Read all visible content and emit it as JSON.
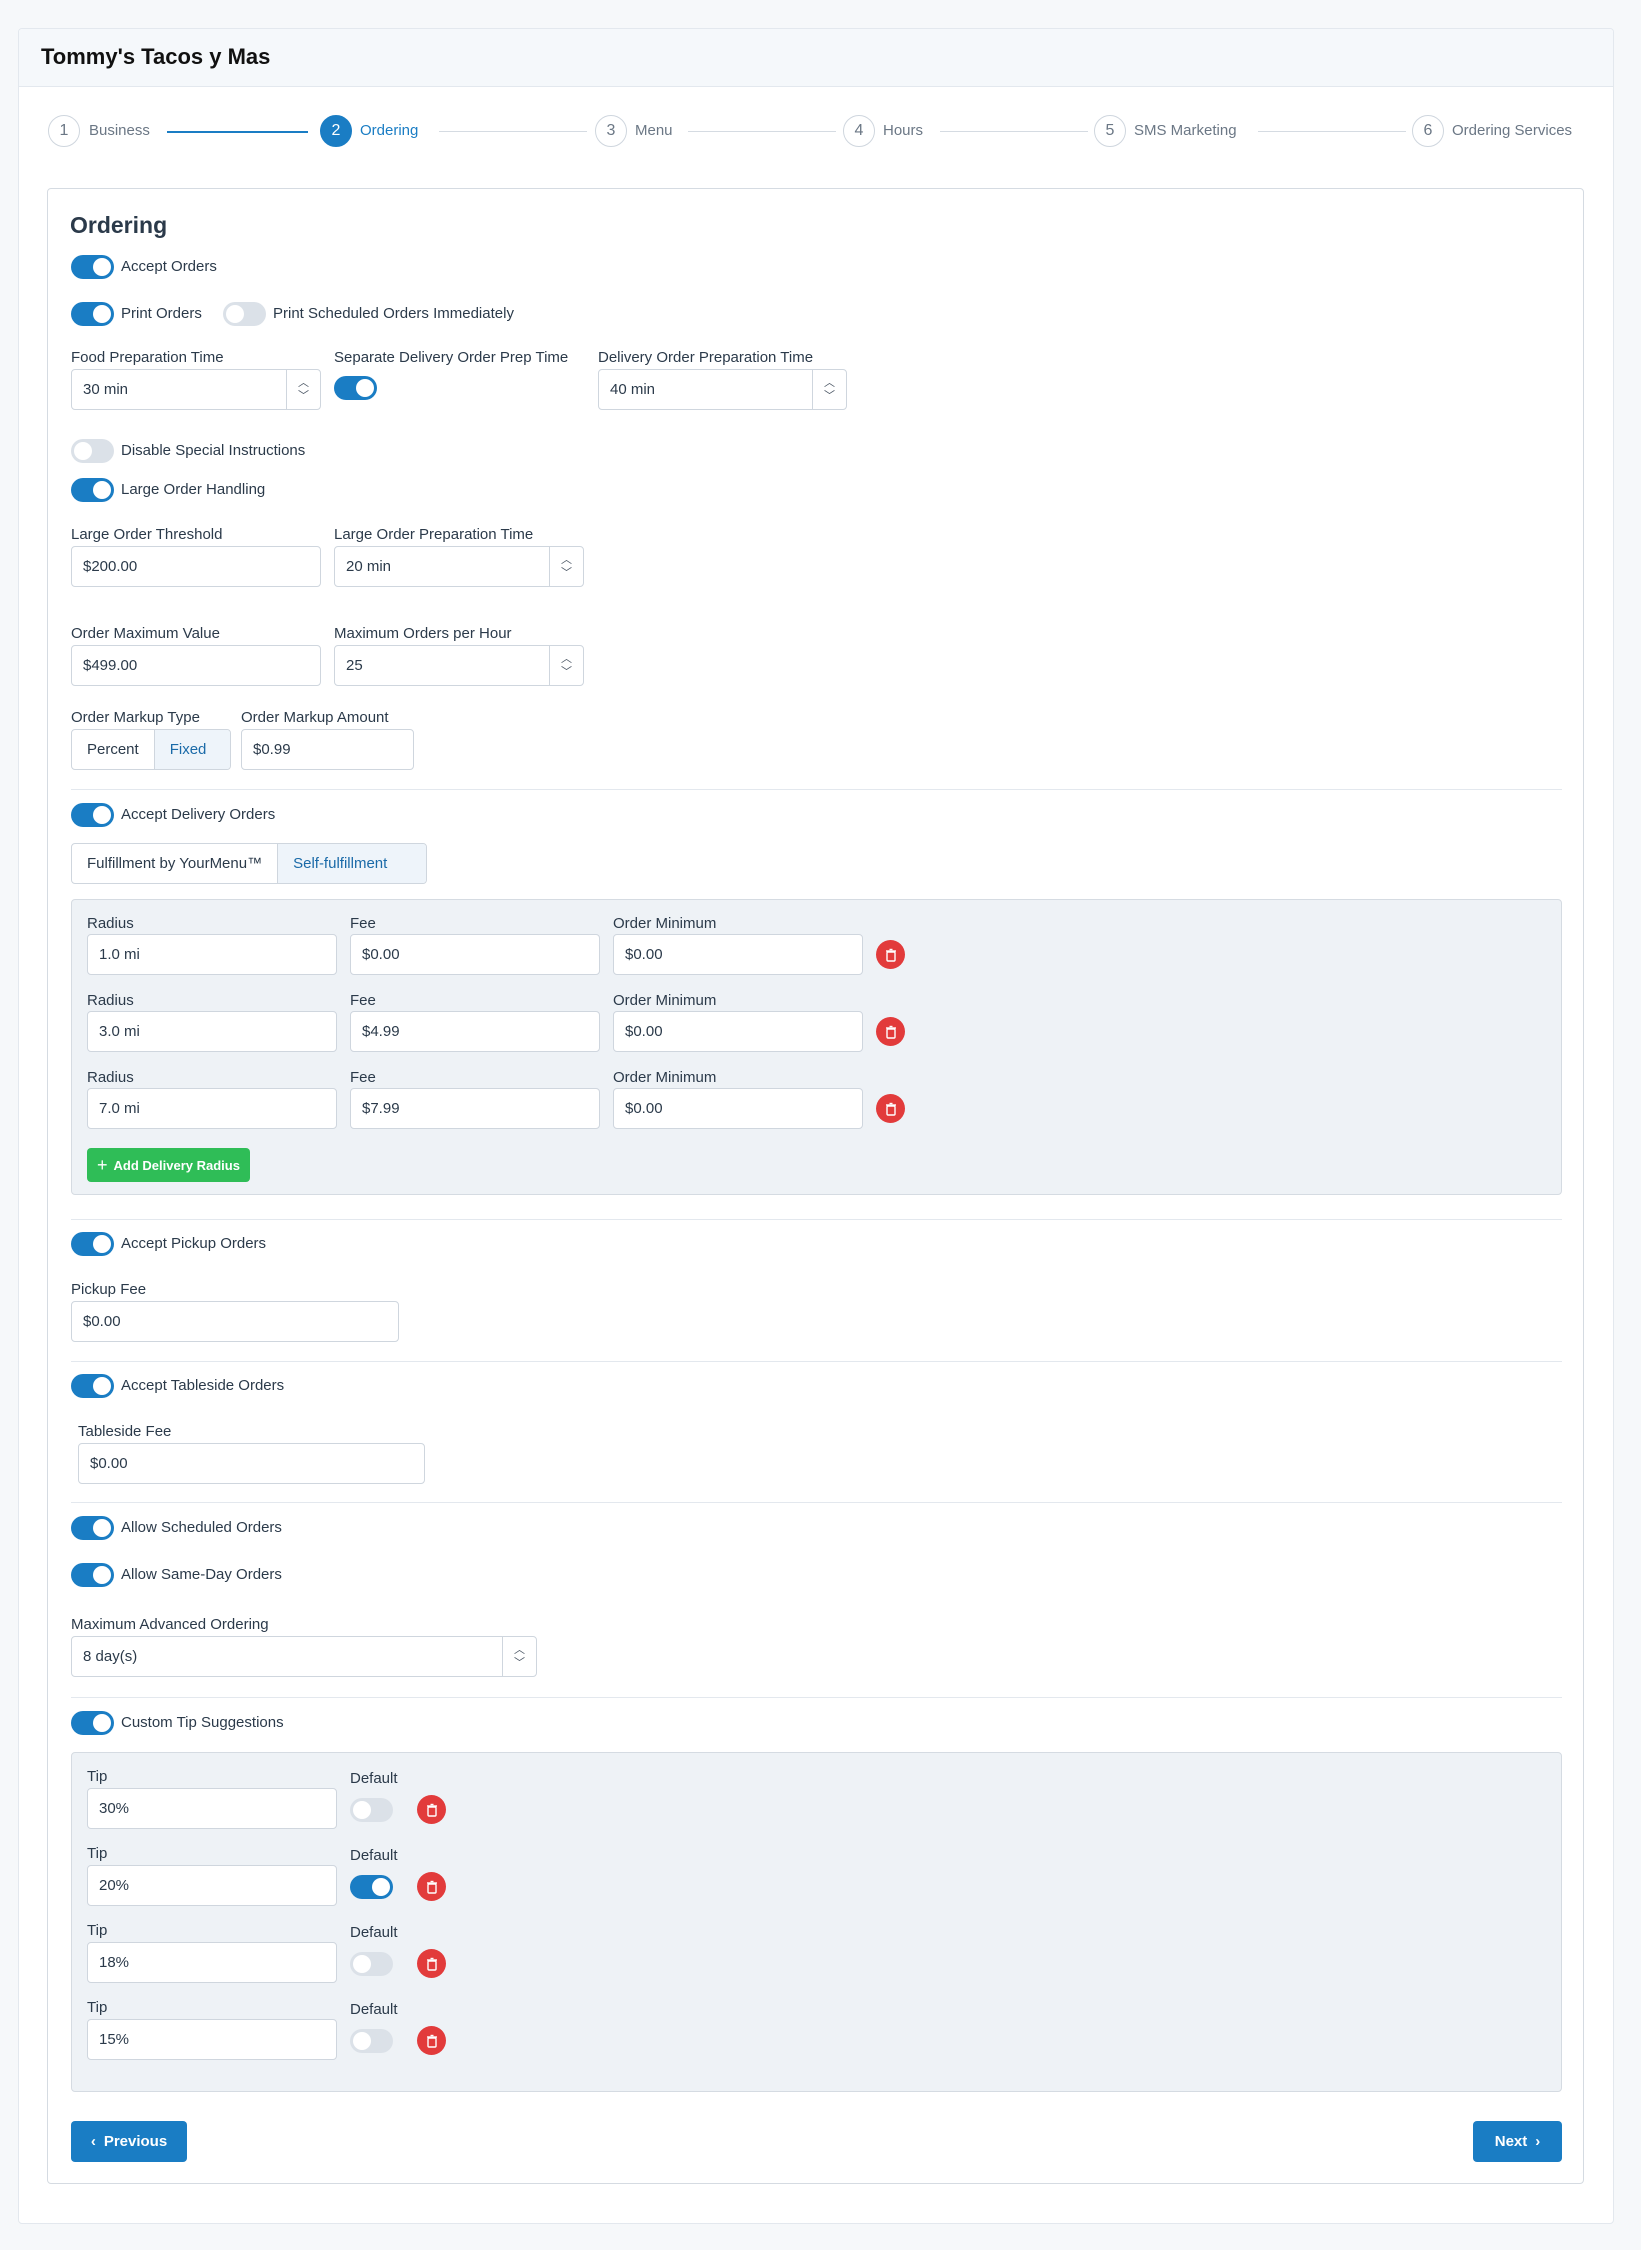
{
  "app": {
    "title": "Tommy's Tacos y Mas"
  },
  "stepper": [
    {
      "num": "1",
      "label": "Business"
    },
    {
      "num": "2",
      "label": "Ordering"
    },
    {
      "num": "3",
      "label": "Menu"
    },
    {
      "num": "4",
      "label": "Hours"
    },
    {
      "num": "5",
      "label": "SMS Marketing"
    },
    {
      "num": "6",
      "label": "Ordering Services"
    }
  ],
  "section": {
    "title": "Ordering"
  },
  "toggles": {
    "accept_orders": "Accept Orders",
    "print_orders": "Print Orders",
    "print_scheduled": "Print Scheduled Orders Immediately",
    "disable_special": "Disable Special Instructions",
    "large_order": "Large Order Handling",
    "accept_delivery": "Accept Delivery Orders",
    "accept_pickup": "Accept Pickup Orders",
    "accept_tableside": "Accept Tableside Orders",
    "allow_scheduled": "Allow Scheduled Orders",
    "allow_same_day": "Allow Same-Day Orders",
    "custom_tip": "Custom Tip Suggestions"
  },
  "fields": {
    "food_prep": {
      "label": "Food Preparation Time",
      "value": "30 min"
    },
    "separate_delivery": {
      "label": "Separate Delivery Order Prep Time"
    },
    "delivery_prep": {
      "label": "Delivery Order Preparation Time",
      "value": "40 min"
    },
    "large_threshold": {
      "label": "Large Order Threshold",
      "value": "$200.00"
    },
    "large_prep": {
      "label": "Large Order Preparation Time",
      "value": "20 min"
    },
    "order_max": {
      "label": "Order Maximum Value",
      "value": "$499.00"
    },
    "max_per_hour": {
      "label": "Maximum Orders per Hour",
      "value": "25"
    },
    "markup_type": {
      "label": "Order Markup Type",
      "options": [
        "Percent",
        "Fixed"
      ],
      "selected": "Fixed"
    },
    "markup_amount": {
      "label": "Order Markup Amount",
      "value": "$0.99"
    },
    "pickup_fee": {
      "label": "Pickup Fee",
      "value": "$0.00"
    },
    "tableside_fee": {
      "label": "Tableside Fee",
      "value": "$0.00"
    },
    "max_advanced": {
      "label": "Maximum Advanced Ordering",
      "value": "8 day(s)"
    }
  },
  "fulfillment": {
    "options": [
      "Fulfillment by YourMenu™",
      "Self-fulfillment"
    ],
    "selected": "Self-fulfillment"
  },
  "delivery": {
    "labels": {
      "radius": "Radius",
      "fee": "Fee",
      "minimum": "Order Minimum"
    },
    "rows": [
      {
        "radius": "1.0 mi",
        "fee": "$0.00",
        "minimum": "$0.00"
      },
      {
        "radius": "3.0 mi",
        "fee": "$4.99",
        "minimum": "$0.00"
      },
      {
        "radius": "7.0 mi",
        "fee": "$7.99",
        "minimum": "$0.00"
      }
    ],
    "add_label": "Add Delivery Radius"
  },
  "tips": {
    "labels": {
      "tip": "Tip",
      "default": "Default"
    },
    "rows": [
      {
        "value": "30%",
        "default": false
      },
      {
        "value": "20%",
        "default": true
      },
      {
        "value": "18%",
        "default": false
      },
      {
        "value": "15%",
        "default": false
      }
    ]
  },
  "nav": {
    "previous": "Previous",
    "next": "Next"
  },
  "colors": {
    "primary": "#1a7dc4",
    "danger": "#e23b3b",
    "success": "#2fbd57"
  }
}
